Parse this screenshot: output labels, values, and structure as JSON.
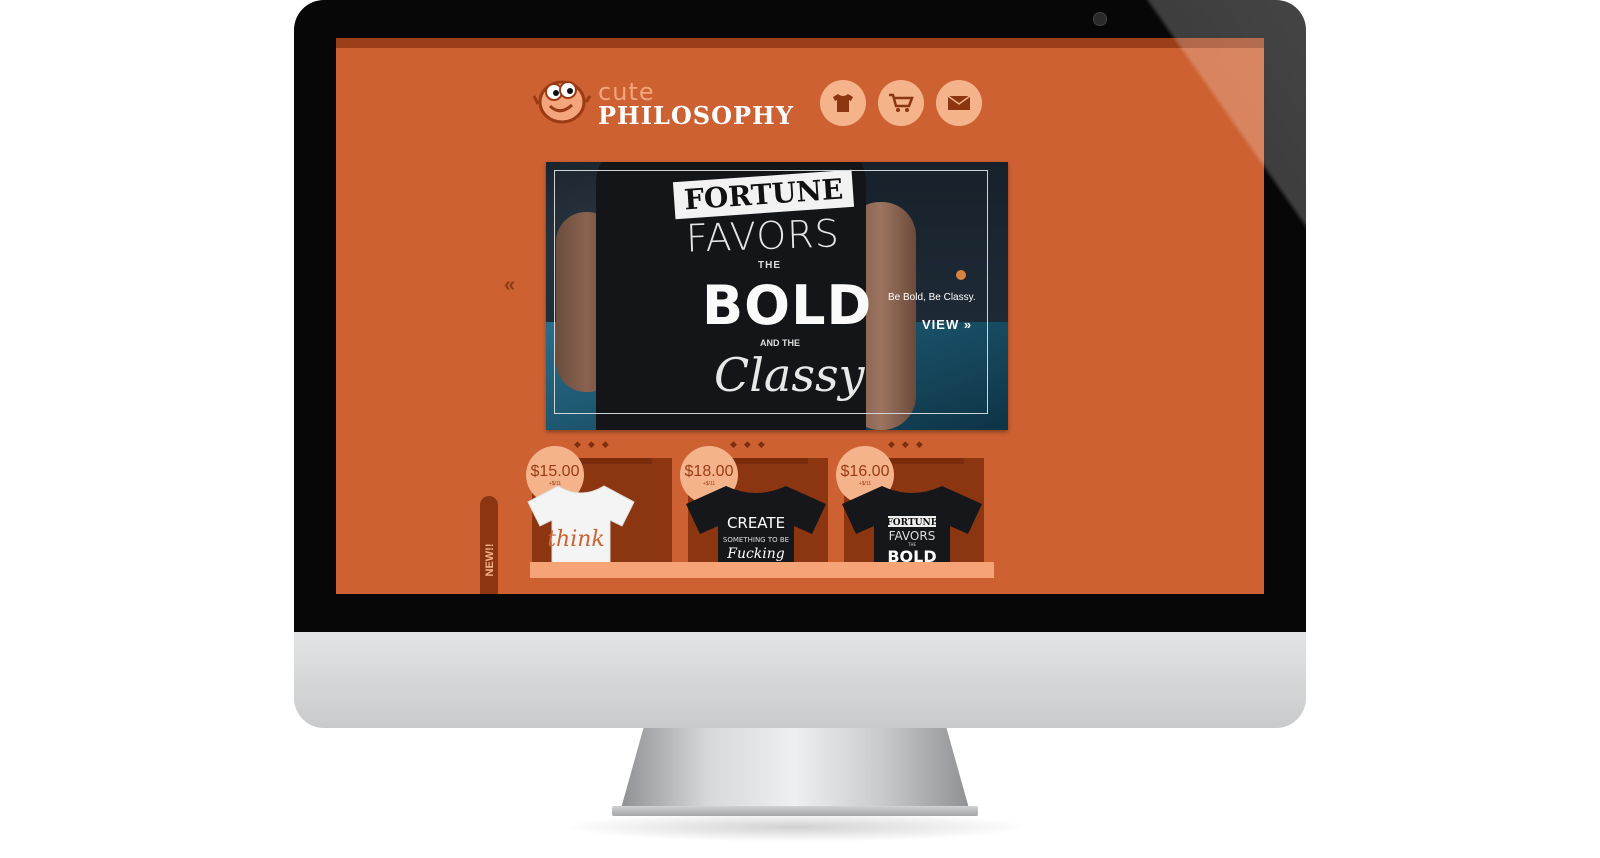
{
  "site": {
    "logo_line1": "cute",
    "logo_line2": "PHILOSOPHY"
  },
  "nav": [
    {
      "icon": "tshirt-icon"
    },
    {
      "icon": "cart-icon"
    },
    {
      "icon": "mail-icon"
    }
  ],
  "hero": {
    "shirt_text": {
      "fortune": "FORTUNE",
      "favors": "FAVORS",
      "the": "THE",
      "bold": "BOLD",
      "and": "AND THE",
      "classy": "Classy"
    },
    "caption": "Be Bold, Be Classy.",
    "view_label": "VIEW »",
    "prev_arrow": "«",
    "next_arrow": "»"
  },
  "products": [
    {
      "price": "$15.00",
      "sub": "+$/11",
      "shirt_color": "white",
      "shirt_text": "think"
    },
    {
      "price": "$18.00",
      "sub": "+$/11",
      "shirt_color": "black",
      "shirt_text": "CREATE SOMETHING ... Fucking PROUD"
    },
    {
      "price": "$16.00",
      "sub": "+$/11",
      "shirt_color": "black",
      "shirt_text": "FORTUNE FAVORS THE BOLD AND THE Classy"
    }
  ],
  "new_ribbon": "NEW!!",
  "colors": {
    "page_bg": "#cd6132",
    "topbar": "#9b3f18",
    "accent_light": "#f5b38c",
    "product_panel": "#8c3511"
  }
}
